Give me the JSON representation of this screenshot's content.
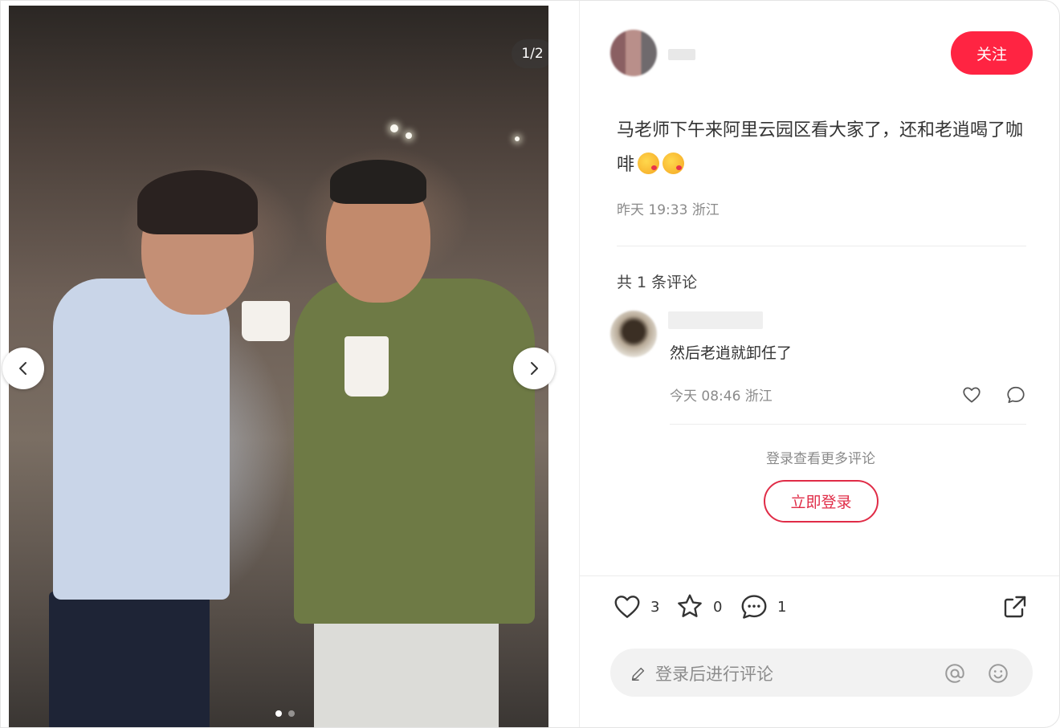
{
  "media": {
    "counter": "1/2",
    "dots_total": 2,
    "active_dot": 1
  },
  "author": {
    "follow_label": "关注"
  },
  "post": {
    "text": "马老师下午来阿里云园区看大家了，还和老逍喝了咖啡",
    "emojis": [
      "kiss-emoji",
      "kiss-emoji"
    ],
    "meta": "昨天 19:33 浙江"
  },
  "comments": {
    "count_label": "共 1 条评论",
    "items": [
      {
        "text": "然后老逍就卸任了",
        "meta": "今天 08:46 浙江"
      }
    ],
    "more_hint": "登录查看更多评论",
    "login_label": "立即登录"
  },
  "actions": {
    "likes": "3",
    "collects": "0",
    "comments": "1"
  },
  "comment_bar": {
    "placeholder": "登录后进行评论"
  },
  "colors": {
    "accent": "#ff2442",
    "login_border": "#e02c47"
  }
}
